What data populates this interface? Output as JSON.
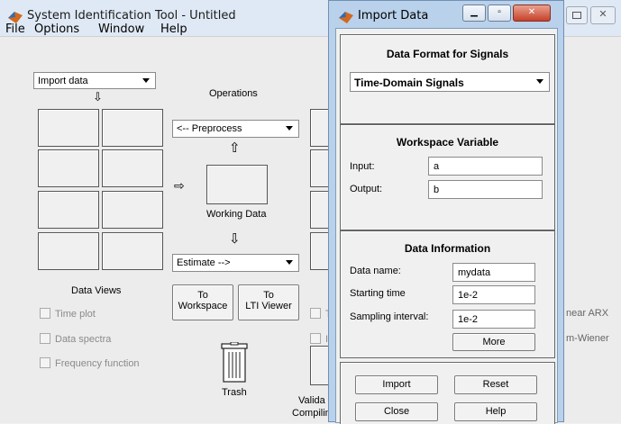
{
  "main_window": {
    "title": "System Identification Tool - Untitled",
    "menu": [
      "File",
      "Options",
      "Window",
      "Help"
    ],
    "import_data_dropdown": "Import data",
    "operations_label": "Operations",
    "preprocess_dropdown": "<-- Preprocess",
    "working_data_label": "Working Data",
    "estimate_dropdown": "Estimate -->",
    "data_views_label": "Data Views",
    "to_workspace_label": "To\nWorkspace",
    "to_workspace_line1": "To",
    "to_workspace_line2": "Workspace",
    "to_lti_line1": "To",
    "to_lti_line2": "LTI Viewer",
    "data_views": [
      "Time plot",
      "Data spectra",
      "Frequency function"
    ],
    "model_view_partial": [
      "T",
      "I"
    ],
    "trash_label": "Trash",
    "validation_partial": "Valida",
    "compiling_partial": "Compilin",
    "right_partial_1": "near ARX",
    "right_partial_2": "m-Wiener"
  },
  "import_dialog": {
    "title": "Import Data",
    "data_format_title": "Data Format for Signals",
    "data_format_value": "Time-Domain Signals",
    "workspace_title": "Workspace Variable",
    "input_label": "Input:",
    "input_value": "a",
    "output_label": "Output:",
    "output_value": "b",
    "info_title": "Data Information",
    "data_name_label": "Data name:",
    "data_name_value": "mydata",
    "starting_time_label": "Starting time",
    "starting_time_value": "1e-2",
    "sampling_interval_label": "Sampling interval:",
    "sampling_interval_value": "1e-2",
    "more_label": "More",
    "import_label": "Import",
    "reset_label": "Reset",
    "close_label": "Close",
    "help_label": "Help"
  },
  "colors": {
    "dialog_frame": "#b9d1ea",
    "window_bg": "#f0f0f0",
    "close_button": "#c6412a"
  }
}
